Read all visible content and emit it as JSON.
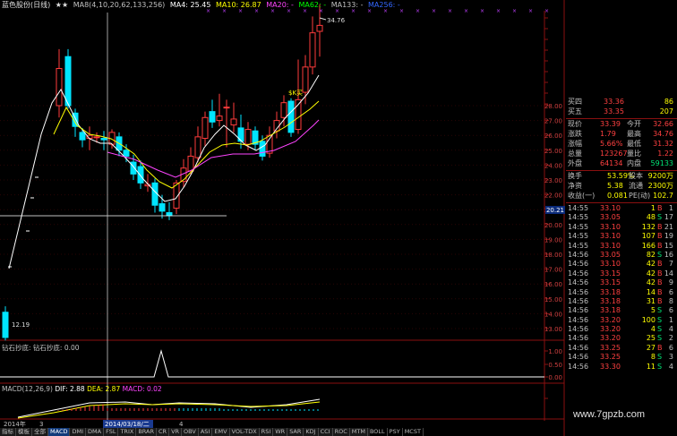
{
  "header": {
    "title": "蓝色股份(日线)",
    "stars": "★★",
    "ma_label": "MA8(4,10,20,62,133,256)",
    "ma4": "MA4: 25.45",
    "ma10": "MA10: 26.87",
    "ma20": "MA20: -",
    "ma62": "MA62: -",
    "ma133": "MA133: -",
    "ma256": "MA256: -"
  },
  "price_axis": [
    "28.00",
    "27.00",
    "26.00",
    "25.00",
    "24.00",
    "23.00",
    "22.00",
    "21.00",
    "20.00",
    "19.00",
    "18.00",
    "17.00",
    "16.00",
    "15.00",
    "14.00",
    "13.00"
  ],
  "price_marks": {
    "high_label": "34.76",
    "low_label": "12.19",
    "current_marker": "20.21",
    "mid_label": "$K买"
  },
  "quote": {
    "buy1": {
      "label": "买四",
      "price": "33.36",
      "vol": "86"
    },
    "buy5": {
      "label": "买五",
      "price": "33.35",
      "vol": "207"
    },
    "rows": [
      {
        "l1": "现价",
        "v1": "33.39",
        "l2": "今开",
        "v2": "32.66"
      },
      {
        "l1": "涨跌",
        "v1": "1.79",
        "l2": "最高",
        "v2": "34.76"
      },
      {
        "l1": "涨幅",
        "v1": "5.66%",
        "l2": "最低",
        "v2": "31.32"
      },
      {
        "l1": "总量",
        "v1": "123267",
        "l2": "量比",
        "v2": "1.22"
      },
      {
        "l1": "外盘",
        "v1": "64134",
        "l2": "内盘",
        "v2": "59133"
      }
    ],
    "stats": [
      {
        "l1": "换手",
        "v1": "53.59%",
        "l2": "股本",
        "v2": "9200万"
      },
      {
        "l1": "净资",
        "v1": "5.38",
        "l2": "流通",
        "v2": "2300万"
      },
      {
        "l1": "收益(一)",
        "v1": "0.081",
        "l2": "PE(动)",
        "v2": "102.7"
      }
    ]
  },
  "ticks": [
    {
      "t": "14:55",
      "p": "33.10",
      "v": "1",
      "s": "B",
      "n": "1"
    },
    {
      "t": "14:55",
      "p": "33.05",
      "v": "48",
      "s": "S",
      "n": "17"
    },
    {
      "t": "14:55",
      "p": "33.10",
      "v": "132",
      "s": "B",
      "n": "21"
    },
    {
      "t": "14:55",
      "p": "33.10",
      "v": "107",
      "s": "B",
      "n": "19"
    },
    {
      "t": "14:55",
      "p": "33.10",
      "v": "166",
      "s": "B",
      "n": "15"
    },
    {
      "t": "14:56",
      "p": "33.05",
      "v": "82",
      "s": "S",
      "n": "16"
    },
    {
      "t": "14:56",
      "p": "33.10",
      "v": "42",
      "s": "B",
      "n": "7"
    },
    {
      "t": "14:56",
      "p": "33.15",
      "v": "42",
      "s": "B",
      "n": "14"
    },
    {
      "t": "14:56",
      "p": "33.15",
      "v": "42",
      "s": "B",
      "n": "9"
    },
    {
      "t": "14:56",
      "p": "33.18",
      "v": "14",
      "s": "B",
      "n": "6"
    },
    {
      "t": "14:56",
      "p": "33.18",
      "v": "31",
      "s": "B",
      "n": "8"
    },
    {
      "t": "14:56",
      "p": "33.18",
      "v": "5",
      "s": "S",
      "n": "6"
    },
    {
      "t": "14:56",
      "p": "33.20",
      "v": "100",
      "s": "S",
      "n": "1"
    },
    {
      "t": "14:56",
      "p": "33.20",
      "v": "4",
      "s": "S",
      "n": "4"
    },
    {
      "t": "14:56",
      "p": "33.20",
      "v": "25",
      "s": "S",
      "n": "2"
    },
    {
      "t": "14:56",
      "p": "33.25",
      "v": "27",
      "s": "B",
      "n": "6"
    },
    {
      "t": "14:56",
      "p": "33.25",
      "v": "8",
      "s": "S",
      "n": "3"
    },
    {
      "t": "14:56",
      "p": "33.30",
      "v": "11",
      "s": "S",
      "n": "4"
    }
  ],
  "indicator1": {
    "title": "钻石抄底: 钻石抄底: 0.00",
    "axis": [
      "1.00",
      "0.50",
      "0.00"
    ]
  },
  "indicator2": {
    "title_prefix": "MACD(12,26,9)",
    "dif": "DIF: 2.88",
    "dea": "DEA: 2.87",
    "macd": "MACD: 0.02"
  },
  "timeline": {
    "start": "2014年",
    "m3": "3",
    "sel_date": "2014/03/18/二",
    "m4": "4"
  },
  "tabs": [
    "指标",
    "模板",
    "全部",
    "MACD",
    "DMI",
    "DMA",
    "FSL",
    "TRIX",
    "BRAR",
    "CR",
    "VR",
    "OBV",
    "ASI",
    "EMV",
    "VOL-TDX",
    "RSI",
    "WR",
    "SAR",
    "KDJ",
    "CCI",
    "ROC",
    "MTM",
    "BOLL",
    "PSY",
    "MCST"
  ],
  "active_tab": "MACD",
  "watermark": "www.7gpzb.com",
  "colors": {
    "up": "#ff3b3b",
    "down": "#00e5ff",
    "ma4": "#ffffff",
    "ma10": "#ffff00",
    "ma20": "#ff44ff",
    "ma62": "#00ff00",
    "ma133": "#c0c0c0",
    "ma256": "#3060ff",
    "grid": "#8a1010"
  }
}
